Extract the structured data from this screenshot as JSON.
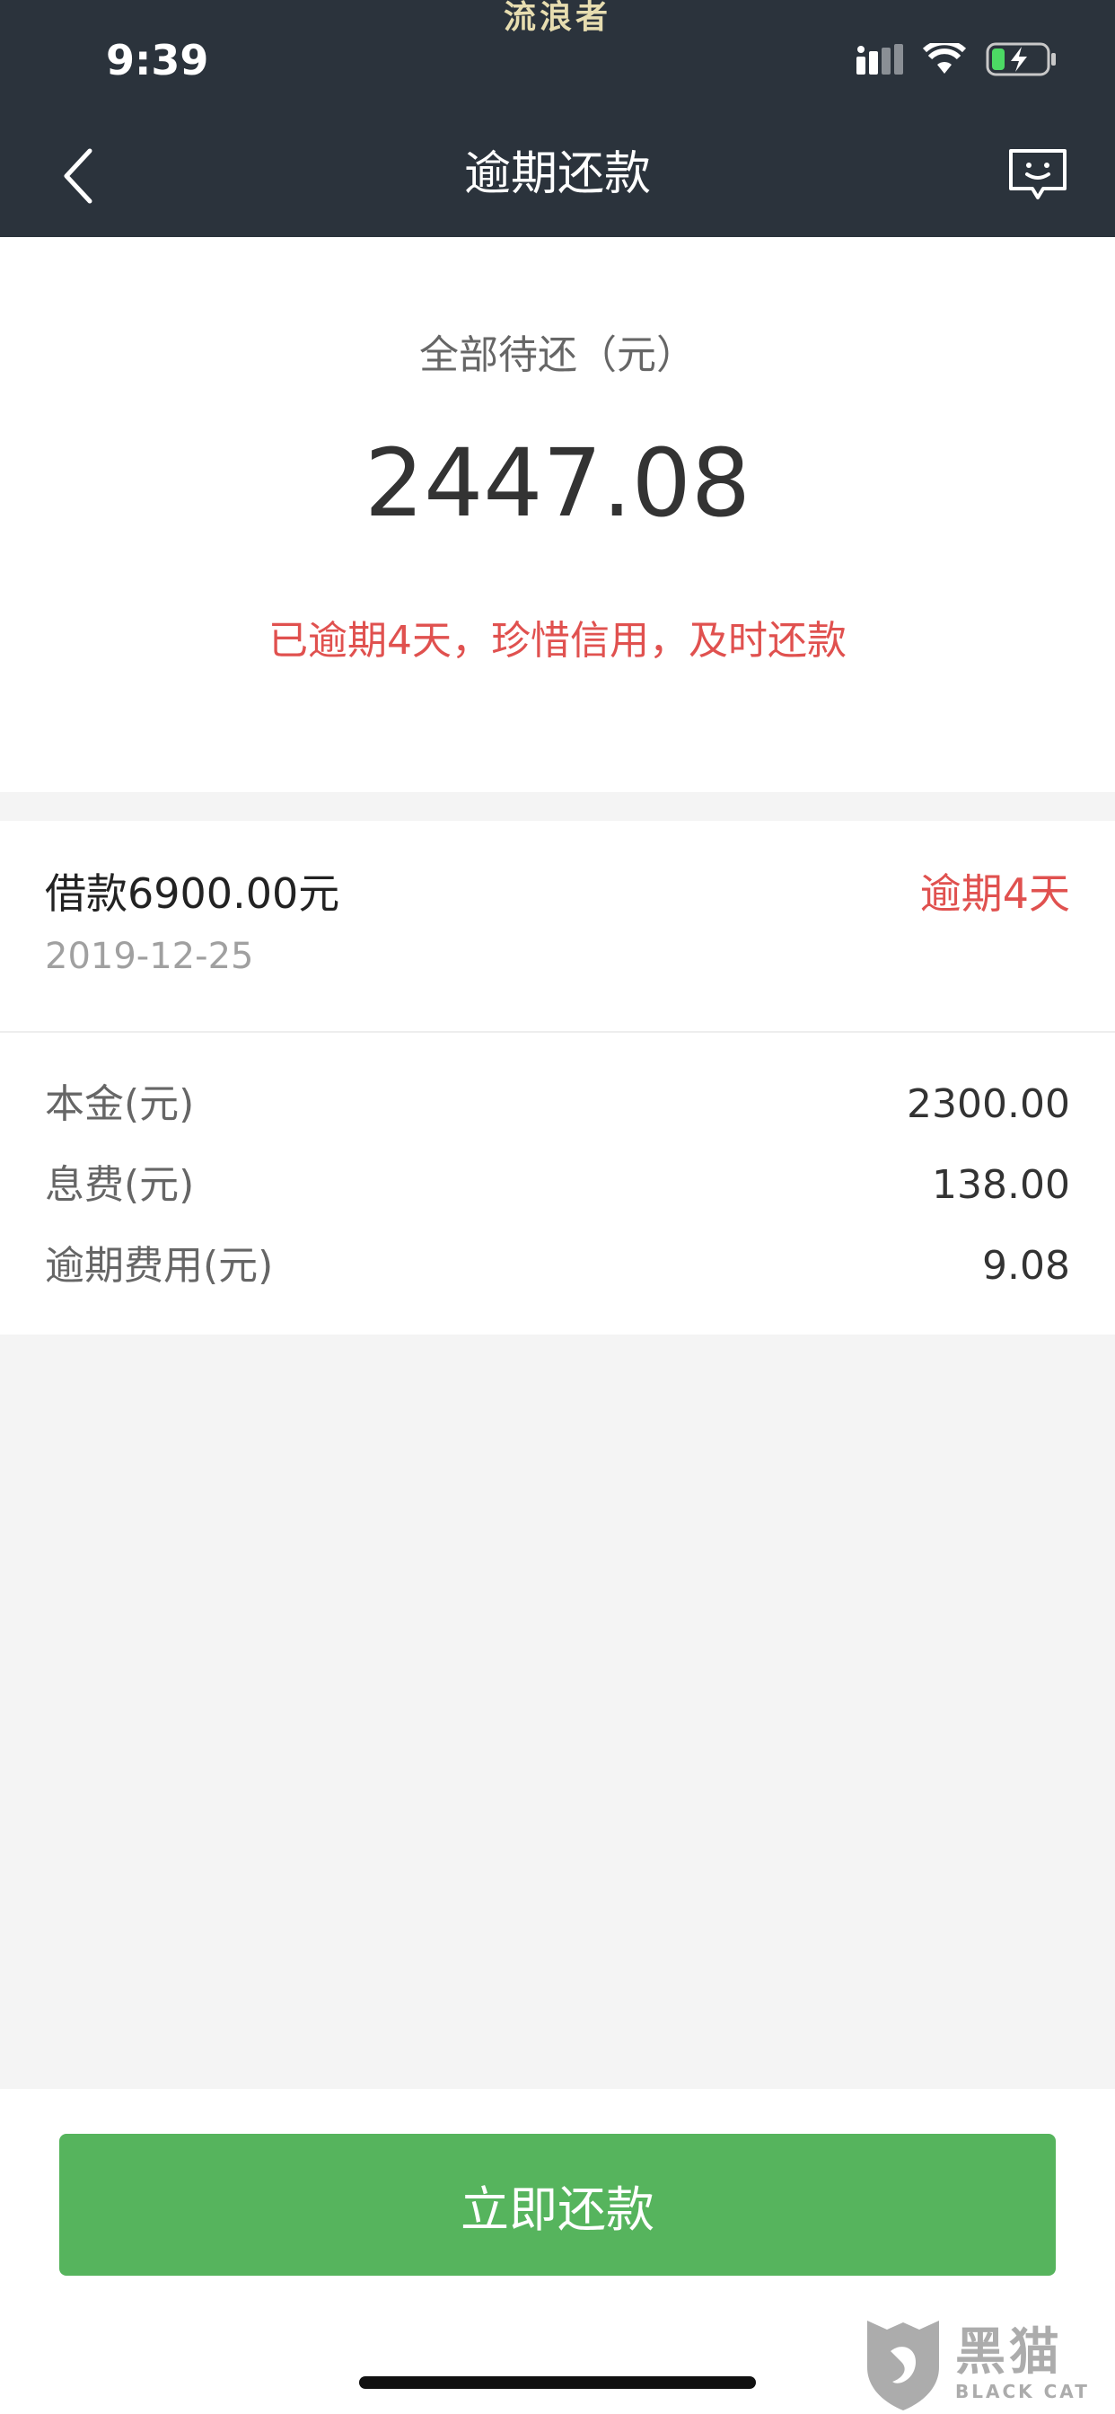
{
  "watermark_top": "流浪者",
  "status_bar": {
    "time": "9:39"
  },
  "nav": {
    "title": "逾期还款"
  },
  "summary": {
    "label": "全部待还（元）",
    "amount": "2447.08",
    "warning": "已逾期4天，珍惜信用，及时还款"
  },
  "loan": {
    "title": "借款6900.00元",
    "date": "2019-12-25",
    "status": "逾期4天",
    "details": [
      {
        "label": "本金(元)",
        "value": "2300.00"
      },
      {
        "label": "息费(元)",
        "value": "138.00"
      },
      {
        "label": "逾期费用(元)",
        "value": "9.08"
      }
    ]
  },
  "actions": {
    "pay_now": "立即还款"
  },
  "brand": {
    "cn": "黑猫",
    "en": "BLACK CAT"
  },
  "colors": {
    "header_bg": "#2b333c",
    "accent_red": "#e0514f",
    "button_green": "#56b45d"
  },
  "icons": [
    "back-chevron-icon",
    "chat-feedback-icon",
    "signal-icon",
    "wifi-icon",
    "battery-charging-icon"
  ]
}
